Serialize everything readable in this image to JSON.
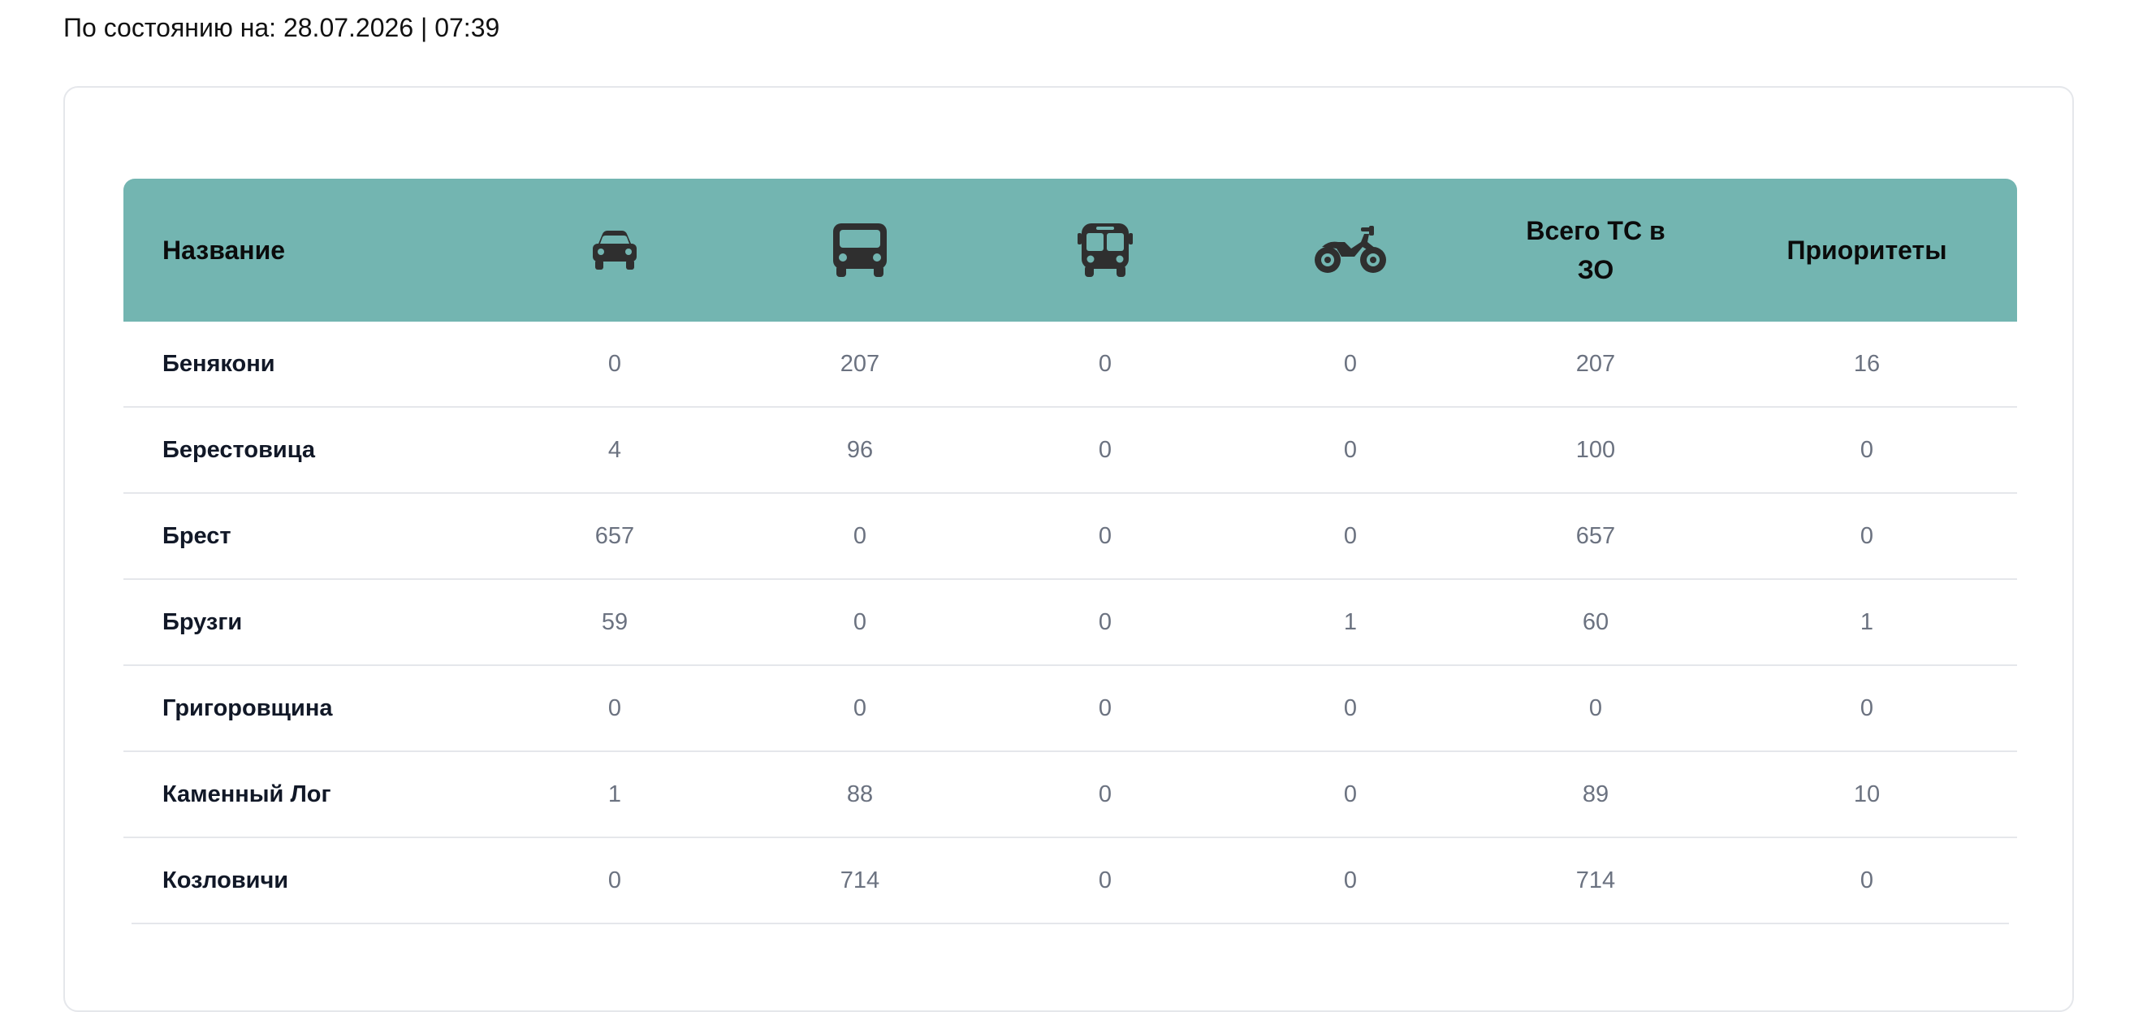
{
  "status": {
    "text": "По состоянию на: 28.07.2026 | 07:39"
  },
  "table": {
    "header_color": "#73b5b1",
    "columns": {
      "name": "Название",
      "cars_icon": "car-icon",
      "trucks_icon": "truck-icon",
      "buses_icon": "bus-icon",
      "motorcycles_icon": "motorcycle-icon",
      "total_line1": "Всего ТС в",
      "total_line2": "ЗО",
      "priorities": "Приоритеты"
    },
    "rows": [
      {
        "name": "Бенякони",
        "cars": "0",
        "trucks": "207",
        "buses": "0",
        "motorcycles": "0",
        "total": "207",
        "priorities": "16"
      },
      {
        "name": "Берестовица",
        "cars": "4",
        "trucks": "96",
        "buses": "0",
        "motorcycles": "0",
        "total": "100",
        "priorities": "0"
      },
      {
        "name": "Брест",
        "cars": "657",
        "trucks": "0",
        "buses": "0",
        "motorcycles": "0",
        "total": "657",
        "priorities": "0"
      },
      {
        "name": "Брузги",
        "cars": "59",
        "trucks": "0",
        "buses": "0",
        "motorcycles": "1",
        "total": "60",
        "priorities": "1"
      },
      {
        "name": "Григоровщина",
        "cars": "0",
        "trucks": "0",
        "buses": "0",
        "motorcycles": "0",
        "total": "0",
        "priorities": "0"
      },
      {
        "name": "Каменный Лог",
        "cars": "1",
        "trucks": "88",
        "buses": "0",
        "motorcycles": "0",
        "total": "89",
        "priorities": "10"
      },
      {
        "name": "Козловичи",
        "cars": "0",
        "trucks": "714",
        "buses": "0",
        "motorcycles": "0",
        "total": "714",
        "priorities": "0"
      }
    ]
  }
}
